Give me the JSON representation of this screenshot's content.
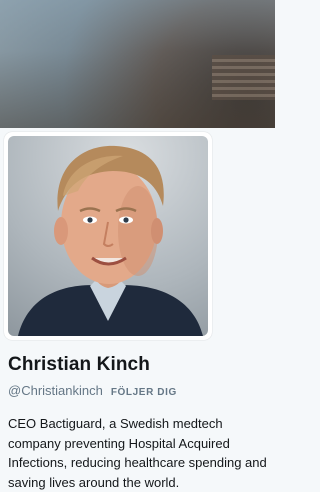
{
  "profile": {
    "name": "Christian Kinch",
    "handle": "@Christiankinch",
    "follows_you": "FÖLJER DIG",
    "bio": "CEO Bactiguard, a Swedish medtech company preventing Hospital Acquired Infections, reducing healthcare spending and saving lives around the world."
  },
  "colors": {
    "text_primary": "#14171a",
    "text_secondary": "#657786",
    "background": "#f5f8fa"
  }
}
